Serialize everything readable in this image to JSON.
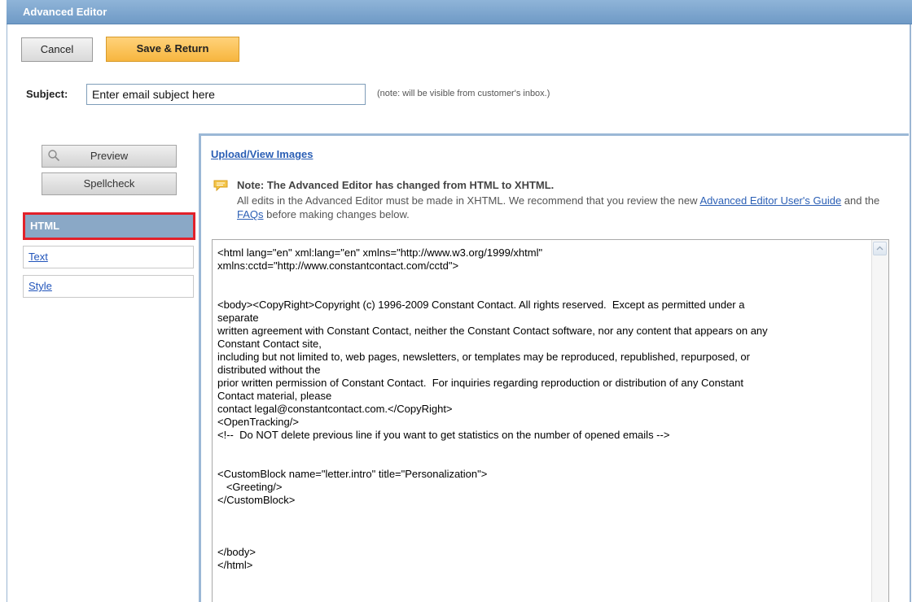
{
  "window": {
    "title": "Advanced Editor"
  },
  "toolbar": {
    "cancel_label": "Cancel",
    "save_label": "Save & Return"
  },
  "subject": {
    "label": "Subject:",
    "value": "Enter email subject here",
    "note": "(note: will be visible from customer's inbox.)"
  },
  "sidebar": {
    "preview_label": "Preview",
    "spellcheck_label": "Spellcheck",
    "tabs": [
      {
        "label": "HTML",
        "active": true
      },
      {
        "label": "Text",
        "active": false
      },
      {
        "label": "Style",
        "active": false
      }
    ]
  },
  "panel": {
    "upload_link": "Upload/View Images",
    "note_title": "Note: The Advanced Editor has changed from HTML to XHTML.",
    "note_text_1": "All edits in the Advanced Editor must be made in XHTML. We recommend that you review the new ",
    "note_link_1": "Advanced Editor User's Guide",
    "note_text_2": " and the ",
    "note_link_2": "FAQs",
    "note_text_3": " before making changes below.",
    "code": "<html lang=\"en\" xml:lang=\"en\" xmlns=\"http://www.w3.org/1999/xhtml\"\nxmlns:cctd=\"http://www.constantcontact.com/cctd\">\n\n\n<body><CopyRight>Copyright (c) 1996-2009 Constant Contact. All rights reserved.  Except as permitted under a\nseparate\nwritten agreement with Constant Contact, neither the Constant Contact software, nor any content that appears on any\nConstant Contact site,\nincluding but not limited to, web pages, newsletters, or templates may be reproduced, republished, repurposed, or\ndistributed without the\nprior written permission of Constant Contact.  For inquiries regarding reproduction or distribution of any Constant\nContact material, please\ncontact legal@constantcontact.com.</CopyRight>\n<OpenTracking/>\n<!--  Do NOT delete previous line if you want to get statistics on the number of opened emails -->\n\n\n<CustomBlock name=\"letter.intro\" title=\"Personalization\">\n   <Greeting/>\n</CustomBlock>\n\n\n\n</body>\n</html>"
  },
  "colors": {
    "title_bar": "#7aa3cd",
    "save_button": "#f9c35a",
    "active_tab": "#8aa8c6",
    "highlight": "#e2212a",
    "link": "#2b5fb5"
  }
}
